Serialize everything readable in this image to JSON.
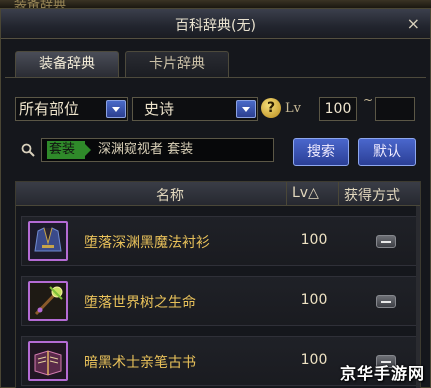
{
  "window": {
    "title": "百科辞典(无)",
    "close_glyph": "×"
  },
  "top_strip": {
    "text": "装备辞典"
  },
  "tabs": [
    {
      "label": "装备辞典",
      "active": true
    },
    {
      "label": "卡片辞典",
      "active": false
    }
  ],
  "filters": {
    "part_select": "所有部位",
    "rarity_select": "史诗",
    "help_glyph": "?",
    "lv_label": "Lv",
    "lv_min": "100",
    "lv_sep": "~",
    "lv_max": ""
  },
  "search": {
    "tag": "套装",
    "text": "深渊窥视者  套装",
    "search_button": "搜索",
    "default_button": "默认"
  },
  "table": {
    "headers": {
      "name": "名称",
      "lv": "Lv△",
      "obtain": "获得方式"
    },
    "rows": [
      {
        "name": "堕落深渊黑魔法衬衫",
        "lv": "100",
        "icon": "robe-icon"
      },
      {
        "name": "堕落世界树之生命",
        "lv": "100",
        "icon": "staff-icon"
      },
      {
        "name": "暗黑术士亲笔古书",
        "lv": "100",
        "icon": "book-icon"
      }
    ]
  },
  "watermark": "京华手游网",
  "colors": {
    "item_name": "#e8c15a",
    "button_blue": "#3b55b8",
    "epic_border": "#b46bd4",
    "tag_green": "#2f8a2a"
  }
}
